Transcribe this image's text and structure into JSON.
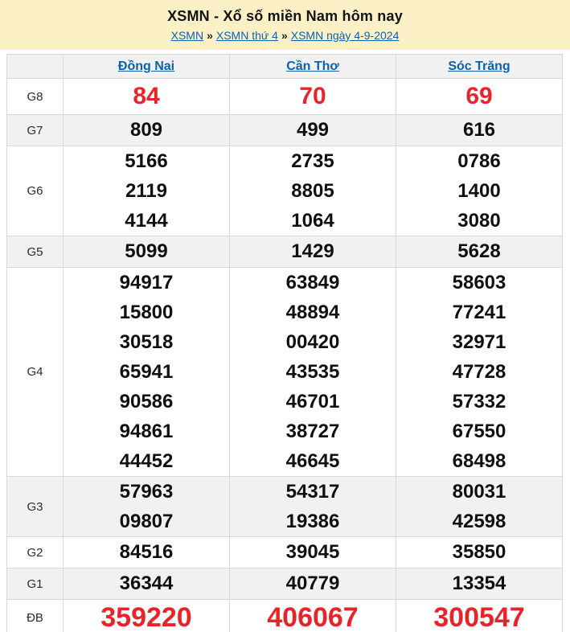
{
  "header": {
    "title": "XSMN - Xổ số miền Nam hôm nay",
    "breadcrumb": [
      "XSMN",
      "XSMN thứ 4",
      "XSMN ngày 4-9-2024"
    ],
    "separator": "»"
  },
  "table": {
    "provinces": [
      "Đồng Nai",
      "Cần Thơ",
      "Sóc Trăng"
    ],
    "rows": [
      {
        "prize": "G8",
        "values": [
          [
            "84"
          ],
          [
            "70"
          ],
          [
            "69"
          ]
        ]
      },
      {
        "prize": "G7",
        "values": [
          [
            "809"
          ],
          [
            "499"
          ],
          [
            "616"
          ]
        ]
      },
      {
        "prize": "G6",
        "values": [
          [
            "5166",
            "2119",
            "4144"
          ],
          [
            "2735",
            "8805",
            "1064"
          ],
          [
            "0786",
            "1400",
            "3080"
          ]
        ]
      },
      {
        "prize": "G5",
        "values": [
          [
            "5099"
          ],
          [
            "1429"
          ],
          [
            "5628"
          ]
        ]
      },
      {
        "prize": "G4",
        "values": [
          [
            "94917",
            "15800",
            "30518",
            "65941",
            "90586",
            "94861",
            "44452"
          ],
          [
            "63849",
            "48894",
            "00420",
            "43535",
            "46701",
            "38727",
            "46645"
          ],
          [
            "58603",
            "77241",
            "32971",
            "47728",
            "57332",
            "67550",
            "68498"
          ]
        ]
      },
      {
        "prize": "G3",
        "values": [
          [
            "57963",
            "09807"
          ],
          [
            "54317",
            "19386"
          ],
          [
            "80031",
            "42598"
          ]
        ]
      },
      {
        "prize": "G2",
        "values": [
          [
            "84516"
          ],
          [
            "39045"
          ],
          [
            "35850"
          ]
        ]
      },
      {
        "prize": "G1",
        "values": [
          [
            "36344"
          ],
          [
            "40779"
          ],
          [
            "13354"
          ]
        ]
      },
      {
        "prize": "ĐB",
        "values": [
          [
            "359220"
          ],
          [
            "406067"
          ],
          [
            "300547"
          ]
        ]
      }
    ]
  },
  "colors": {
    "band_yellow": "#fbf0c6",
    "stripe_gray": "#f1f1f1",
    "link_blue": "#0a62b1",
    "accent_red": "#e8242b"
  }
}
